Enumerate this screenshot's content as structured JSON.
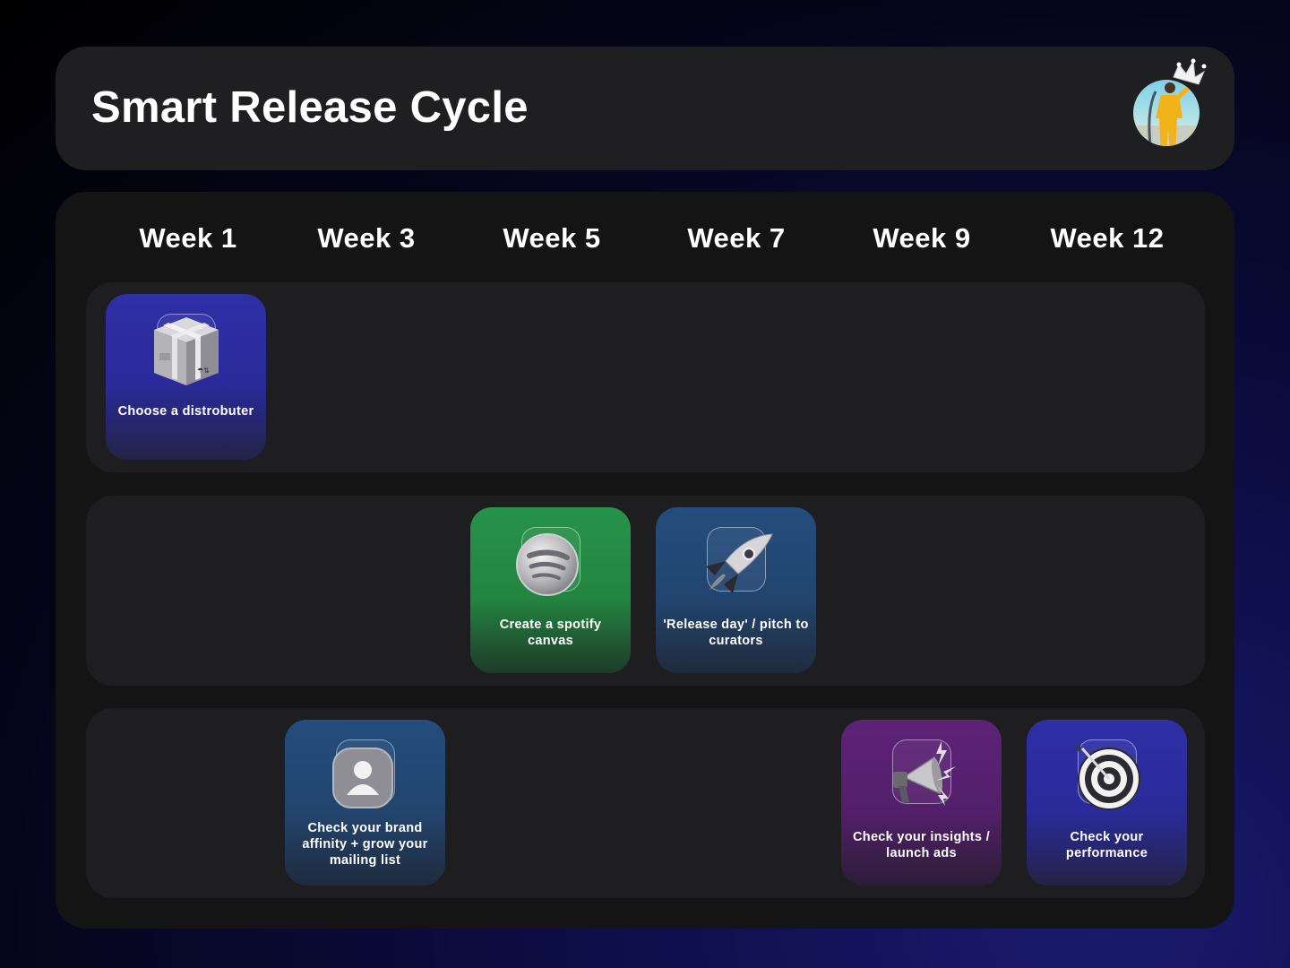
{
  "header": {
    "title": "Smart Release Cycle"
  },
  "avatar": {
    "icon": "profile-avatar-with-crown"
  },
  "weeks": [
    "Week 1",
    "Week 3",
    "Week 5",
    "Week 7",
    "Week 9",
    "Week 12"
  ],
  "cards": {
    "distributor": {
      "label": "Choose a distrobuter",
      "icon": "package-box-icon",
      "color": "#2f2fa6"
    },
    "spotify_canvas": {
      "label": "Create a spotify canvas",
      "icon": "spotify-icon",
      "color": "#27934a"
    },
    "release_day": {
      "label": "'Release day' / pitch to curators",
      "icon": "rocket-icon",
      "color": "#244c7c"
    },
    "brand_affinity": {
      "label": "Check your brand affinity + grow your mailing list",
      "icon": "user-profile-icon",
      "color": "#244c7c"
    },
    "insights": {
      "label": "Check your insights / launch ads",
      "icon": "megaphone-icon",
      "color": "#5d2277"
    },
    "performance": {
      "label": "Check your performance",
      "icon": "target-icon",
      "color": "#2f2fa6"
    }
  }
}
